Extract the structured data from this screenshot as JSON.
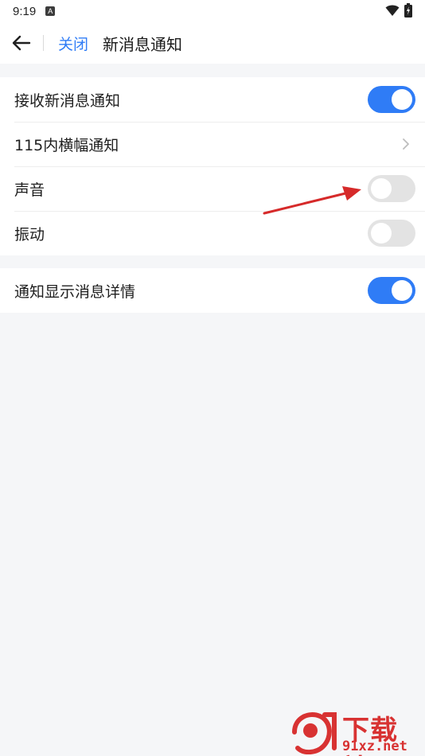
{
  "status_bar": {
    "time": "9:19",
    "a_badge": "A",
    "icons": [
      "wifi-icon",
      "battery-icon"
    ]
  },
  "header": {
    "back_icon": "arrow-left-icon",
    "close_label": "关闭",
    "title": "新消息通知"
  },
  "settings": {
    "group1": [
      {
        "label": "接收新消息通知",
        "control": "toggle",
        "state": "on"
      },
      {
        "label": "115内横幅通知",
        "control": "chevron"
      },
      {
        "label": "声音",
        "control": "toggle",
        "state": "off"
      },
      {
        "label": "振动",
        "control": "toggle",
        "state": "off"
      }
    ],
    "group2": [
      {
        "label": "通知显示消息详情",
        "control": "toggle",
        "state": "on"
      }
    ]
  },
  "colors": {
    "accent": "#2f7cf6",
    "toggle_off": "#e3e3e3",
    "annotation": "#d62a2a",
    "watermark": "#d83232"
  },
  "watermark": {
    "logo_text": "9",
    "title": "下载站",
    "domain": "91xz.net"
  }
}
